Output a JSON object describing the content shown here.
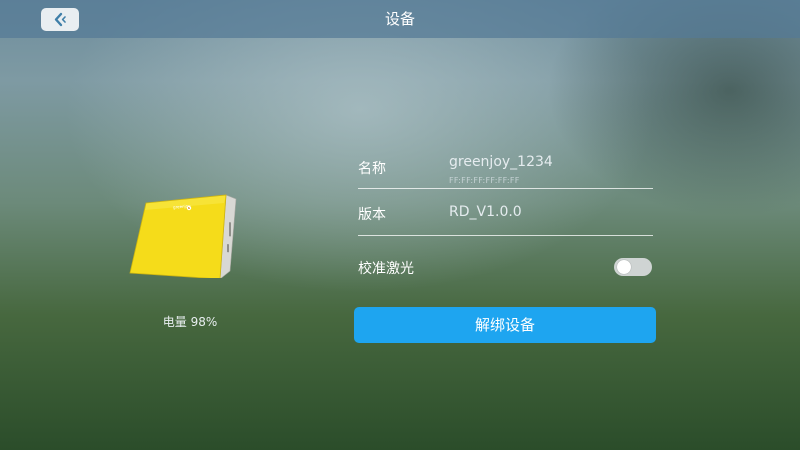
{
  "header": {
    "title": "设备"
  },
  "device": {
    "battery_label": "电量 98%",
    "brand_mark": "greenjoy"
  },
  "info": {
    "name_label": "名称",
    "name_value": "greenjoy_1234",
    "mac_address": "FF:FF:FF:FF:FF:FF",
    "version_label": "版本",
    "version_value": "RD_V1.0.0",
    "calibrate_label": "校准激光",
    "calibrate_on": false
  },
  "actions": {
    "unbind_label": "解绑设备"
  },
  "colors": {
    "accent": "#1ea5f0",
    "device_body": "#f5dc1a",
    "topbar": "#547a96"
  },
  "icons": {
    "back": "back-arrow-icon"
  }
}
